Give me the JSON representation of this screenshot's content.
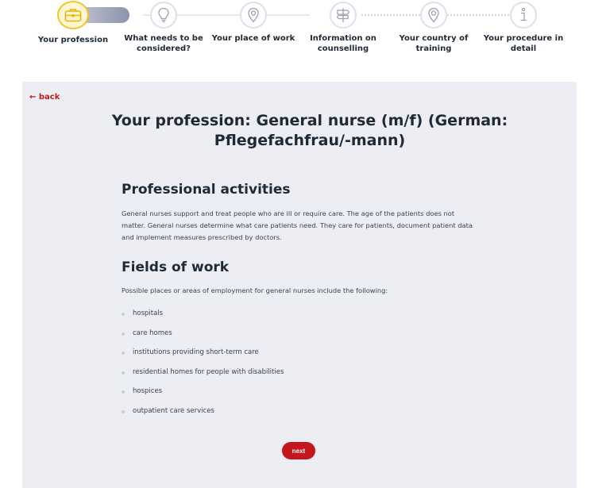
{
  "stepper": {
    "steps": [
      {
        "label": "Your profession",
        "icon": "briefcase-icon",
        "active": true
      },
      {
        "label": "What needs to be considered?",
        "icon": "lightbulb-icon",
        "active": false
      },
      {
        "label": "Your place of work",
        "icon": "location-pin-icon",
        "active": false
      },
      {
        "label": "Information on counselling",
        "icon": "signpost-icon",
        "active": false
      },
      {
        "label": "Your country of training",
        "icon": "location-pin-icon",
        "active": false
      },
      {
        "label": "Your procedure in detail",
        "icon": "info-icon",
        "active": false
      }
    ],
    "accent": "#f3c623"
  },
  "nav": {
    "back_label": "← back"
  },
  "main": {
    "title": "Your profession: General nurse (m/f) (German: Pflegefachfrau/-mann)",
    "sections": [
      {
        "heading": "Professional activities",
        "text": "General nurses support and treat people who are ill or require care. The age of the patients does not matter. General nurses determine what care patients need. They care for patients, document patient data and implement measures prescribed by doctors."
      },
      {
        "heading": "Fields of work",
        "text": "Possible places or areas of employment for general nurses include the following:"
      }
    ],
    "fields": [
      "hospitals",
      "care homes",
      "institutions providing short-term care",
      "residential homes for people with disabilities",
      "hospices",
      "outpatient care services"
    ],
    "next_label": "next"
  },
  "colors": {
    "brand_red": "#c4161c",
    "panel_bg": "#eceef3"
  }
}
